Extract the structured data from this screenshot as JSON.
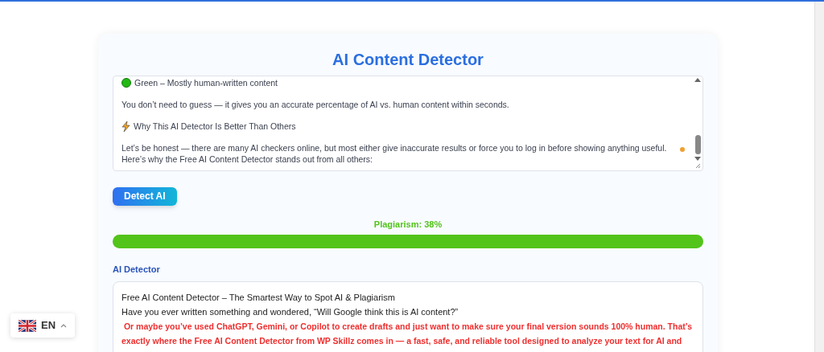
{
  "title": "AI Content Detector",
  "input_text": {
    "paragraphs": [
      {
        "kind": "green-dot",
        "text": "Green – Mostly human-written content"
      },
      {
        "kind": "plain",
        "text": "You don’t need to guess — it gives you an accurate percentage of AI vs. human content within seconds."
      },
      {
        "kind": "bolt",
        "text": "Why This AI Detector Is Better Than Others"
      },
      {
        "kind": "tight",
        "text": "Let’s be honest — there are many AI checkers online, but most either give inaccurate results or force you to log in before showing anything useful."
      },
      {
        "kind": "plain",
        "text": "Here’s why the Free AI Content Detector stands out from all others:"
      }
    ]
  },
  "detect_button": "Detect AI",
  "plagiarism": {
    "label": "Plagiarism: 38%",
    "level": 1.0
  },
  "result_heading": "AI Detector",
  "result_lines": [
    {
      "kind": "plain",
      "text": "Free AI Content Detector – The Smartest Way to Spot AI & Plagiarism"
    },
    {
      "kind": "plain",
      "text": "Have you ever written something and wondered, “Will Google think this is AI content?”"
    },
    {
      "kind": "flagged",
      "text": " Or maybe you’ve used ChatGPT, Gemini, or Copilot to create drafts and just want to make sure your final version sounds 100% human. That’s exactly where the Free AI Content Detector from WP Skillz comes in — a fast, safe, and reliable tool designed to analyze your text for AI and"
    }
  ],
  "language": {
    "code": "EN"
  }
}
